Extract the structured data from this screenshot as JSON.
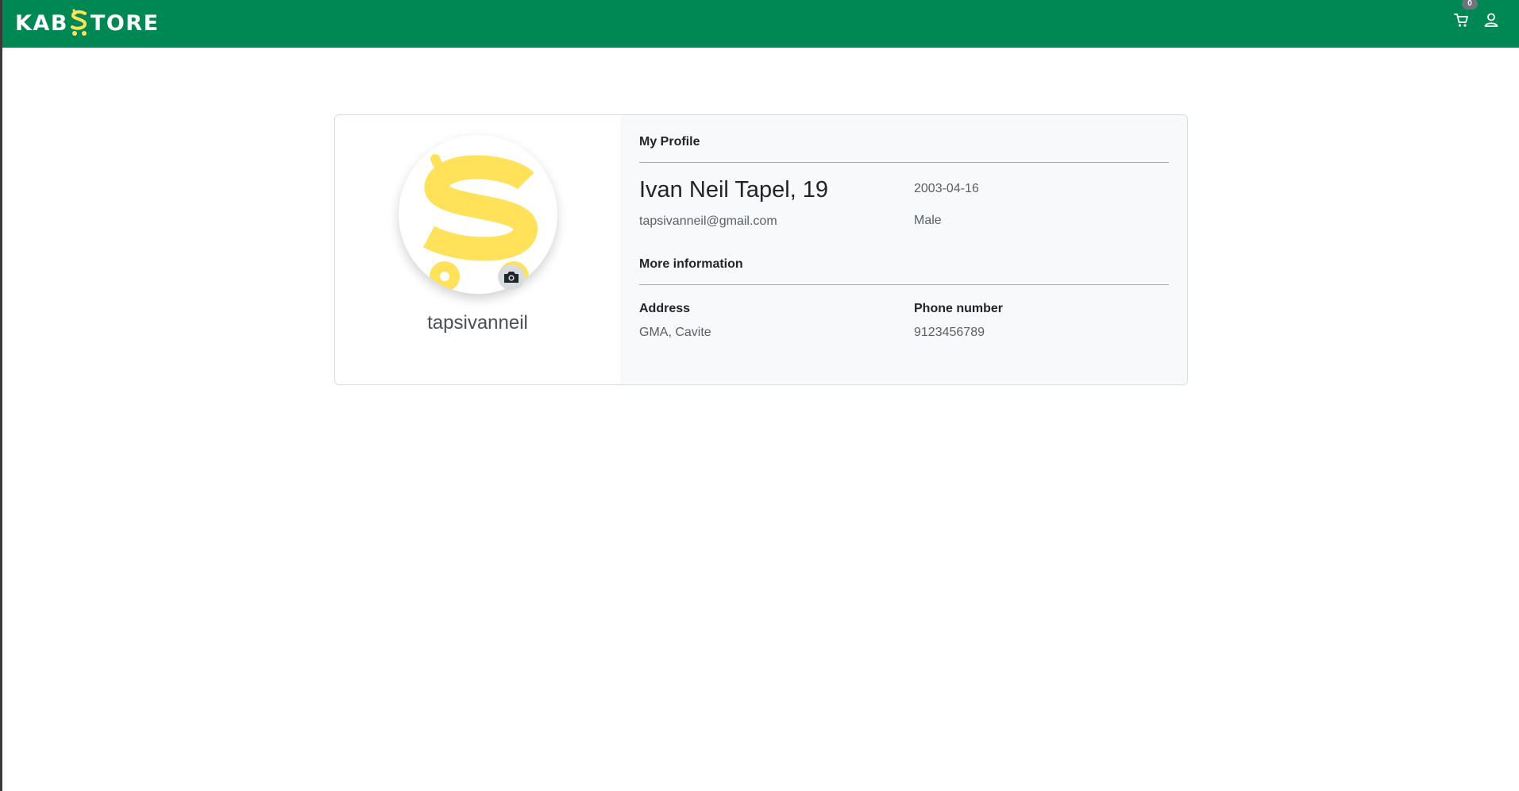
{
  "navbar": {
    "brand_left": "KAB",
    "brand_right": "TORE",
    "cart_icon": "cart-icon",
    "user_icon": "user-icon",
    "cart_count": "0",
    "colors": {
      "bar": "#008854",
      "logo_accent": "#ffe15a"
    }
  },
  "profile": {
    "username": "tapsivanneil",
    "avatar_icon": "kabstore-logo-avatar",
    "camera_icon": "camera-icon",
    "section_title": "My Profile",
    "full_name": "Ivan Neil Tapel, 19",
    "email": "tapsivanneil@gmail.com",
    "birthdate": "2003-04-16",
    "gender": "Male",
    "more_title": "More information",
    "address_label": "Address",
    "address_value": "GMA, Cavite",
    "phone_label": "Phone number",
    "phone_value": "9123456789"
  }
}
